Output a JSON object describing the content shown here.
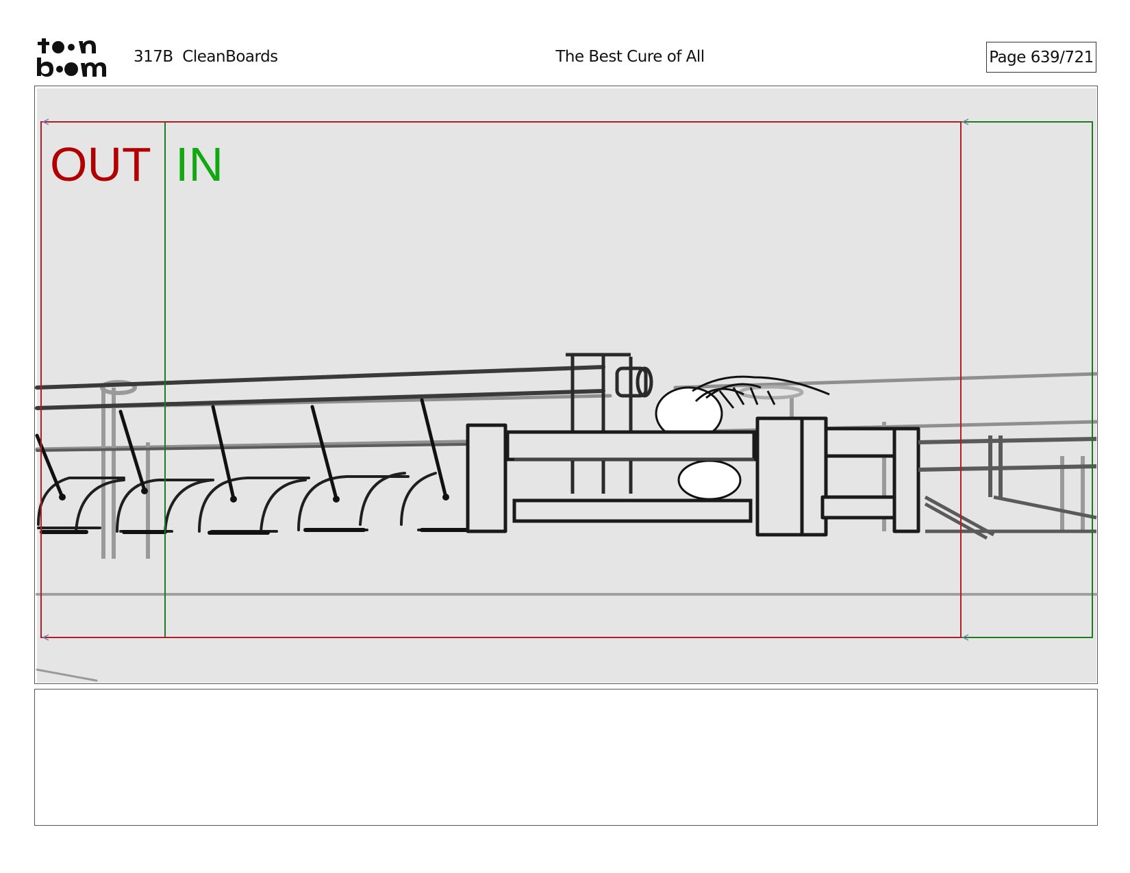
{
  "header": {
    "brand_line1": "to●n",
    "brand_line2": "b●●m",
    "episode": "317B  CleanBoards",
    "title": "The Best Cure of All",
    "page": "Page 639/721"
  },
  "panel": {
    "out_label": "OUT",
    "in_label": "IN",
    "colors": {
      "background": "#e5e5e5",
      "out_frame": "#b01e23",
      "in_frame": "#1e7a1e",
      "out_text": "#b00000",
      "in_text": "#12a812",
      "ink": "#222222",
      "shadow": "#9a9a9a"
    }
  },
  "notes": {
    "text": ""
  }
}
